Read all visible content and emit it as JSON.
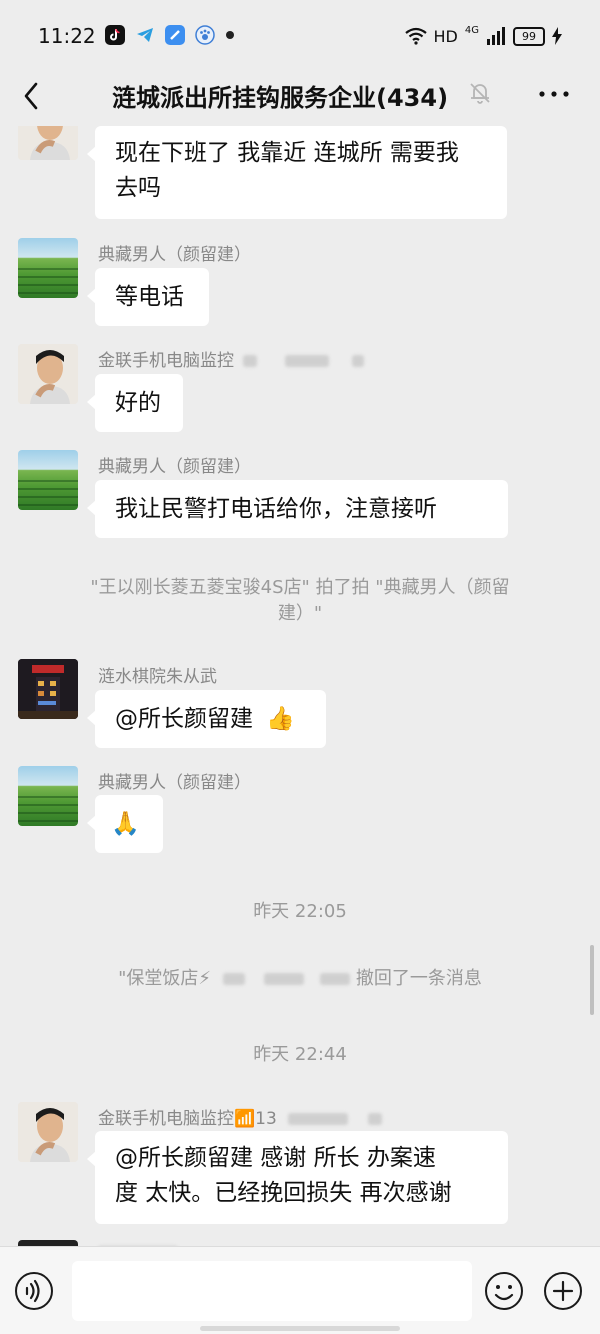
{
  "status_bar": {
    "time": "11:22",
    "network": "HD",
    "signal_label": "4G",
    "battery": "99"
  },
  "header": {
    "title": "涟城派出所挂钩服务企业(434)",
    "icons": [
      "back-icon",
      "mute-bell-icon",
      "more-icon"
    ]
  },
  "messages": {
    "m1": {
      "text_line1": "现在下班了 我靠近 连城所 需要我",
      "text_line2": "去吗"
    },
    "m2": {
      "sender": "典藏男人（颜留建）",
      "text": "等电话"
    },
    "m3": {
      "sender": "金联手机电脑监控",
      "text": "好的"
    },
    "m4": {
      "sender": "典藏男人（颜留建）",
      "text": "我让民警打电话给你，注意接听"
    },
    "sys1": {
      "line1": "\"王以刚长菱五菱宝骏4S店\" 拍了拍 \"典藏男人（颜留",
      "line2": "建）\""
    },
    "m5": {
      "sender": "涟水棋院朱从武",
      "text": "@所长颜留建",
      "emoji": "👍"
    },
    "m6": {
      "sender": "典藏男人（颜留建）",
      "emoji": "🙏"
    },
    "time1": "昨天 22:05",
    "sys2": {
      "prefix": "\"保堂饭店⚡",
      "suffix": "撤回了一条消息"
    },
    "time2": "昨天 22:44",
    "m7": {
      "sender": "金联手机电脑监控📶13",
      "text_line1": "@所长颜留建  感谢 所长 办案速",
      "text_line2": "度 太快。已经挽回损失 再次感谢"
    }
  },
  "input_bar": {
    "placeholder": "",
    "icons": [
      "voice-icon",
      "emoji-icon",
      "plus-icon"
    ]
  },
  "colors": {
    "background": "#ededed",
    "bubble": "#ffffff",
    "sender_text": "#888888",
    "system_text": "#9a9a9a"
  }
}
